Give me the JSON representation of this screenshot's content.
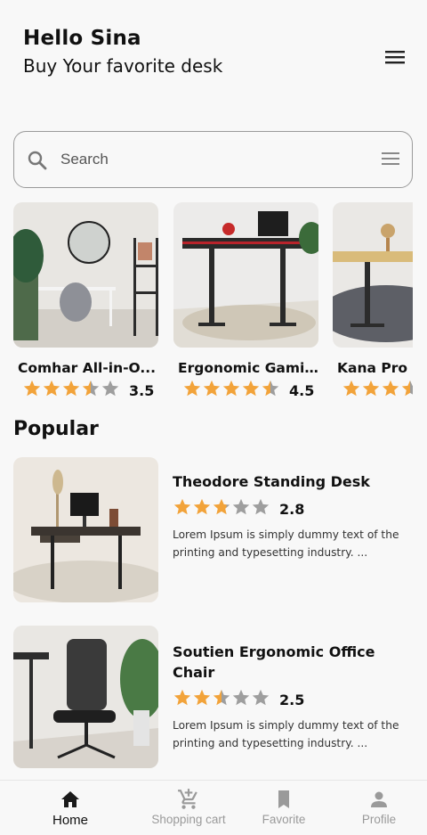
{
  "header": {
    "greeting": "Hello Sina",
    "subtitle": "Buy Your favorite desk"
  },
  "search": {
    "placeholder": "Search"
  },
  "featured": [
    {
      "name": "Comhar All-in-O...",
      "rating": 3.5,
      "rating_label": "3.5"
    },
    {
      "name": "Ergonomic Gamin...",
      "rating": 4.5,
      "rating_label": "4.5"
    },
    {
      "name": "Kana Pro Be",
      "rating": 3.5,
      "rating_label": ""
    }
  ],
  "popular": {
    "title": "Popular",
    "items": [
      {
        "name": "Theodore Standing Desk",
        "rating": 2.8,
        "rating_label": "2.8",
        "description": "Lorem Ipsum is simply dummy text of the printing and typesetting industry. ..."
      },
      {
        "name": "Soutien Ergonomic Office Chair",
        "rating": 2.5,
        "rating_label": "2.5",
        "description": "Lorem Ipsum is simply dummy text of the printing and typesetting industry. ..."
      }
    ]
  },
  "nav": [
    {
      "label": "Home",
      "icon": "home-icon",
      "active": true
    },
    {
      "label": "Shopping cart",
      "icon": "cart-icon",
      "active": false
    },
    {
      "label": "Favorite",
      "icon": "bookmark-icon",
      "active": false
    },
    {
      "label": "Profile",
      "icon": "person-icon",
      "active": false
    }
  ],
  "colors": {
    "star_filled": "#f2a33a",
    "star_empty": "#9e9e9e",
    "text": "#111111",
    "muted": "#9a9a9a"
  }
}
